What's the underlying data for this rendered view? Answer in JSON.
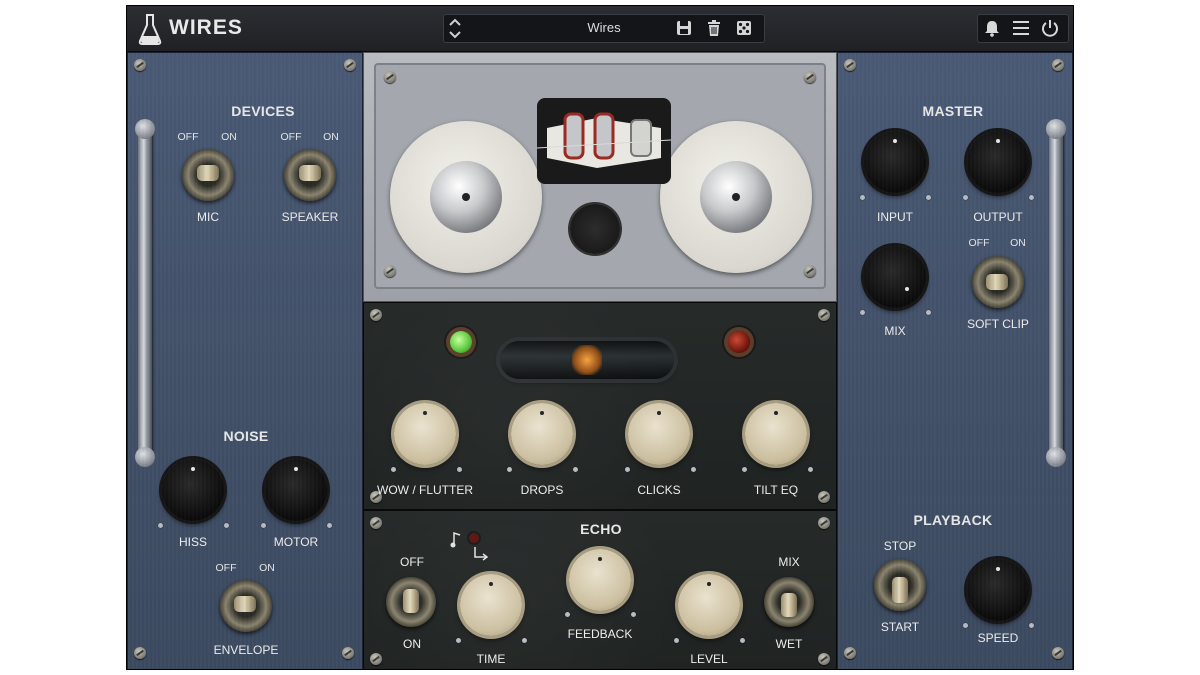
{
  "header": {
    "app_title": "WIRES",
    "preset_name": "Wires"
  },
  "devices": {
    "title": "DEVICES",
    "mic": {
      "label": "MIC",
      "off": "OFF",
      "on": "ON"
    },
    "speaker": {
      "label": "SPEAKER",
      "off": "OFF",
      "on": "ON"
    }
  },
  "noise": {
    "title": "NOISE",
    "hiss_label": "HISS",
    "motor_label": "MOTOR",
    "envelope": {
      "label": "ENVELOPE",
      "off": "OFF",
      "on": "ON"
    }
  },
  "master": {
    "title": "MASTER",
    "input_label": "INPUT",
    "output_label": "OUTPUT",
    "mix_label": "MIX",
    "soft_clip": {
      "label": "SOFT CLIP",
      "off": "OFF",
      "on": "ON"
    }
  },
  "playback": {
    "title": "PLAYBACK",
    "stop_label": "STOP",
    "start_label": "START",
    "speed_label": "SPEED"
  },
  "degrade": {
    "wow_flutter_label": "WOW / FLUTTER",
    "drops_label": "DROPS",
    "clicks_label": "CLICKS",
    "tilt_eq_label": "TILT EQ"
  },
  "echo": {
    "title": "ECHO",
    "off_label": "OFF",
    "on_label": "ON",
    "time_label": "TIME",
    "feedback_label": "FEEDBACK",
    "level_label": "LEVEL",
    "mix_label": "MIX",
    "wet_label": "WET",
    "sync_icon": "note-icon"
  },
  "colors": {
    "panel_blue": "#44536b",
    "fx_dark": "#232726",
    "knob_cream": "#d9cfb5",
    "lamp_green": "#7ee05a",
    "lamp_red": "#8a1a10"
  }
}
